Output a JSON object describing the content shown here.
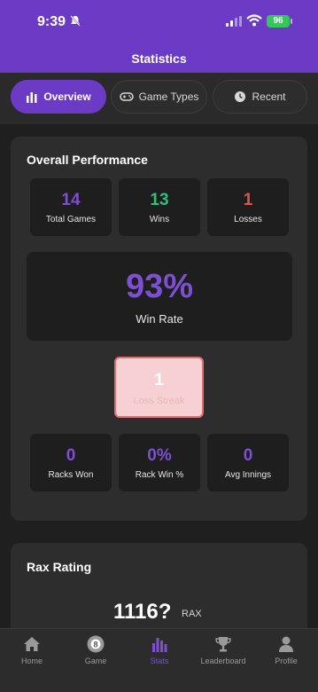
{
  "status_bar": {
    "time": "9:39",
    "battery": "96"
  },
  "header": {
    "title": "Statistics"
  },
  "tabs": [
    {
      "label": "Overview",
      "icon": "bar-chart-icon",
      "active": true
    },
    {
      "label": "Game Types",
      "icon": "gamepad-icon",
      "active": false
    },
    {
      "label": "Recent",
      "icon": "clock-icon",
      "active": false
    }
  ],
  "overall": {
    "title": "Overall Performance",
    "total_games": {
      "value": "14",
      "label": "Total Games"
    },
    "wins": {
      "value": "13",
      "label": "Wins"
    },
    "losses": {
      "value": "1",
      "label": "Losses"
    },
    "win_rate": {
      "value": "93%",
      "label": "Win Rate"
    },
    "streak": {
      "value": "1",
      "label": "Loss Streak"
    },
    "racks_won": {
      "value": "0",
      "label": "Racks Won"
    },
    "rack_win_pct": {
      "value": "0%",
      "label": "Rack Win %"
    },
    "avg_innings": {
      "value": "0",
      "label": "Avg Innings"
    }
  },
  "rax": {
    "title": "Rax Rating",
    "value": "1116?",
    "unit": "RAX"
  },
  "nav": [
    {
      "label": "Home",
      "icon": "home-icon"
    },
    {
      "label": "Game",
      "icon": "ball-8-icon",
      "badge": "8"
    },
    {
      "label": "Stats",
      "icon": "stats-icon",
      "active": true
    },
    {
      "label": "Leaderboard",
      "icon": "trophy-icon"
    },
    {
      "label": "Profile",
      "icon": "profile-icon"
    }
  ],
  "colors": {
    "accent": "#6c3bc6",
    "win": "#2ec27e",
    "loss": "#e5534b"
  }
}
